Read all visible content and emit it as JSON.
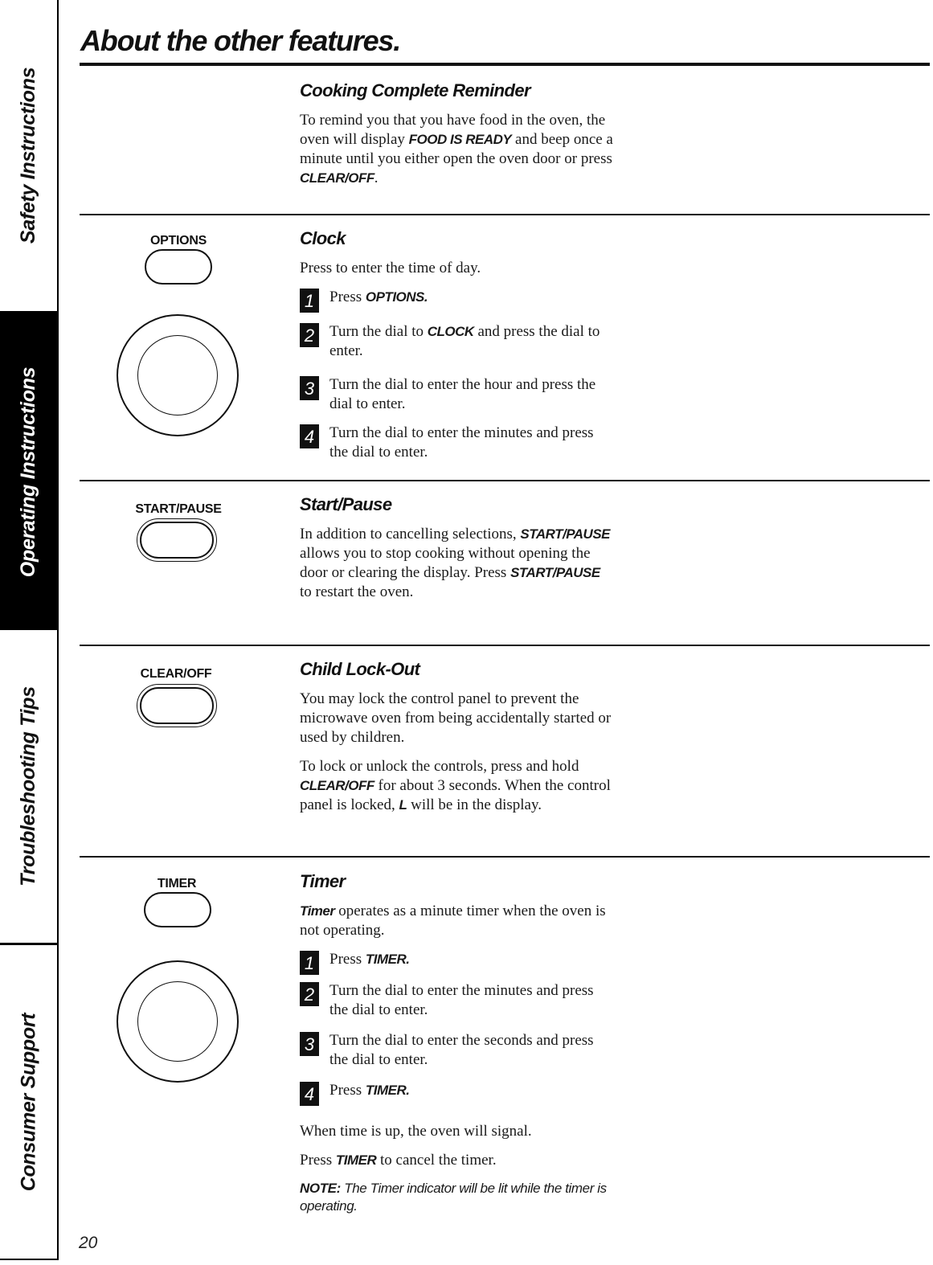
{
  "side_tabs": [
    {
      "label": "Safety Instructions",
      "active": false
    },
    {
      "label": "Operating Instructions",
      "active": true
    },
    {
      "label": "Troubleshooting Tips",
      "active": false
    },
    {
      "label": "Consumer Support",
      "active": false
    }
  ],
  "header": {
    "title": "About the other features."
  },
  "sections": {
    "cooking_complete": {
      "title": "Cooking Complete Reminder",
      "para": {
        "t1": "To remind you that you have food in the oven, the oven will display ",
        "k1": "FOOD IS READY",
        "t2": " and beep once a minute until you either open the oven door or press ",
        "k2": "CLEAR/OFF",
        "t3": "."
      }
    },
    "clock": {
      "title": "Clock",
      "control_label": "OPTIONS",
      "intro": "Press to enter the time of day.",
      "steps": [
        {
          "num": "1",
          "t1": "Press ",
          "k1": "OPTIONS.",
          "t2": ""
        },
        {
          "num": "2",
          "t1": "Turn the dial to ",
          "k1": "CLOCK",
          "t2": " and press the dial to enter."
        },
        {
          "num": "3",
          "t1": "Turn the dial to enter the hour and press the dial to enter.",
          "k1": "",
          "t2": ""
        },
        {
          "num": "4",
          "t1": "Turn the dial to enter the minutes and press the dial to enter.",
          "k1": "",
          "t2": ""
        }
      ]
    },
    "start_pause": {
      "title": "Start/Pause",
      "control_label": "START/PAUSE",
      "para": {
        "t1": "In addition to cancelling selections, ",
        "k1": "START/PAUSE",
        "t2": " allows you to stop cooking without opening the door or clearing the display. Press ",
        "k2": "START/PAUSE",
        "t3": " to restart the oven."
      }
    },
    "child_lock": {
      "title": "Child Lock-Out",
      "control_label": "CLEAR/OFF",
      "para1": "You may lock the control panel to prevent the microwave oven from being accidentally started or used by children.",
      "para2": {
        "t1": "To lock or unlock the controls, press and hold ",
        "k1": "CLEAR/OFF",
        "t2": " for about 3 seconds. When the control panel is locked, ",
        "k2": "L",
        "t3": " will be in the display."
      }
    },
    "timer": {
      "title": "Timer",
      "control_label": "TIMER",
      "intro": {
        "k1": "Timer",
        "t1": " operates as a minute timer when the oven is not operating."
      },
      "steps": [
        {
          "num": "1",
          "t1": "Press ",
          "k1": "TIMER.",
          "t2": ""
        },
        {
          "num": "2",
          "t1": "Turn the dial to enter the minutes and press the dial to enter.",
          "k1": "",
          "t2": ""
        },
        {
          "num": "3",
          "t1": "Turn the dial to enter the seconds and press the dial to enter.",
          "k1": "",
          "t2": ""
        },
        {
          "num": "4",
          "t1": "Press ",
          "k1": "TIMER.",
          "t2": ""
        }
      ],
      "after1": "When time is up, the oven will signal.",
      "after2": {
        "t1": "Press ",
        "k1": "TIMER",
        "t2": " to cancel the timer."
      },
      "note": {
        "label": "NOTE:",
        "text": " The Timer indicator will be lit while the timer is operating."
      }
    }
  },
  "footer": {
    "page_number": "20"
  }
}
